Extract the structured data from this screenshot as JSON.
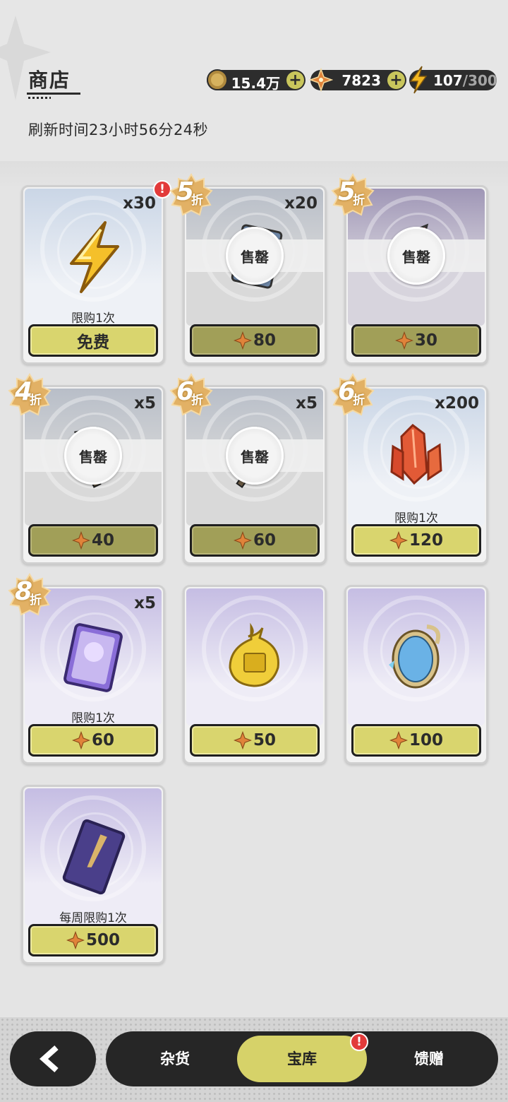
{
  "header": {
    "title": "商店",
    "refresh_text": "刷新时间23小时56分24秒"
  },
  "currencies": {
    "gold": {
      "value": "15.4万",
      "icon": "gold-coin-icon"
    },
    "gem": {
      "value": "7823",
      "icon": "star-gem-icon"
    },
    "stamina": {
      "current": "107",
      "separator": "/",
      "max": "300",
      "icon": "lightning-icon"
    }
  },
  "shop_items": [
    {
      "item": "lightning-stamina",
      "qty": "x30",
      "limit": "限购1次",
      "price": "免费",
      "sold_out": false,
      "alert": "!"
    },
    {
      "item": "blue-card",
      "qty": "x20",
      "discount": "5",
      "discount_suffix": "折",
      "price": "80",
      "sold_out": true,
      "sold_label": "售罄"
    },
    {
      "item": "red-flask",
      "qty": "",
      "discount": "5",
      "discount_suffix": "折",
      "price": "30",
      "sold_out": true,
      "sold_label": "售罄"
    },
    {
      "item": "hammer",
      "qty": "x5",
      "discount": "4",
      "discount_suffix": "折",
      "price": "40",
      "sold_out": true,
      "sold_label": "售罄"
    },
    {
      "item": "pickaxe",
      "qty": "x5",
      "discount": "6",
      "discount_suffix": "折",
      "price": "60",
      "sold_out": true,
      "sold_label": "售罄"
    },
    {
      "item": "red-crystal",
      "qty": "x200",
      "discount": "6",
      "discount_suffix": "折",
      "limit": "限购1次",
      "price": "120",
      "sold_out": false
    },
    {
      "item": "character-card",
      "qty": "x5",
      "discount": "8",
      "discount_suffix": "折",
      "limit": "限购1次",
      "price": "60",
      "sold_out": false
    },
    {
      "item": "golden-pouch",
      "qty": "",
      "price": "50",
      "sold_out": false
    },
    {
      "item": "magic-mirror",
      "qty": "",
      "price": "100",
      "sold_out": false
    },
    {
      "item": "dagger-card",
      "qty": "",
      "limit": "每周限购1次",
      "price": "500",
      "sold_out": false
    }
  ],
  "nav": {
    "tabs": [
      {
        "label": "杂货"
      },
      {
        "label": "宝库",
        "active": true,
        "alert": "!"
      },
      {
        "label": "馈赠"
      }
    ]
  },
  "colors": {
    "buy_button": "#d9d56e",
    "buy_button_disabled": "#a19f58",
    "nav_bg": "#262626",
    "alert": "#e23a3a"
  }
}
